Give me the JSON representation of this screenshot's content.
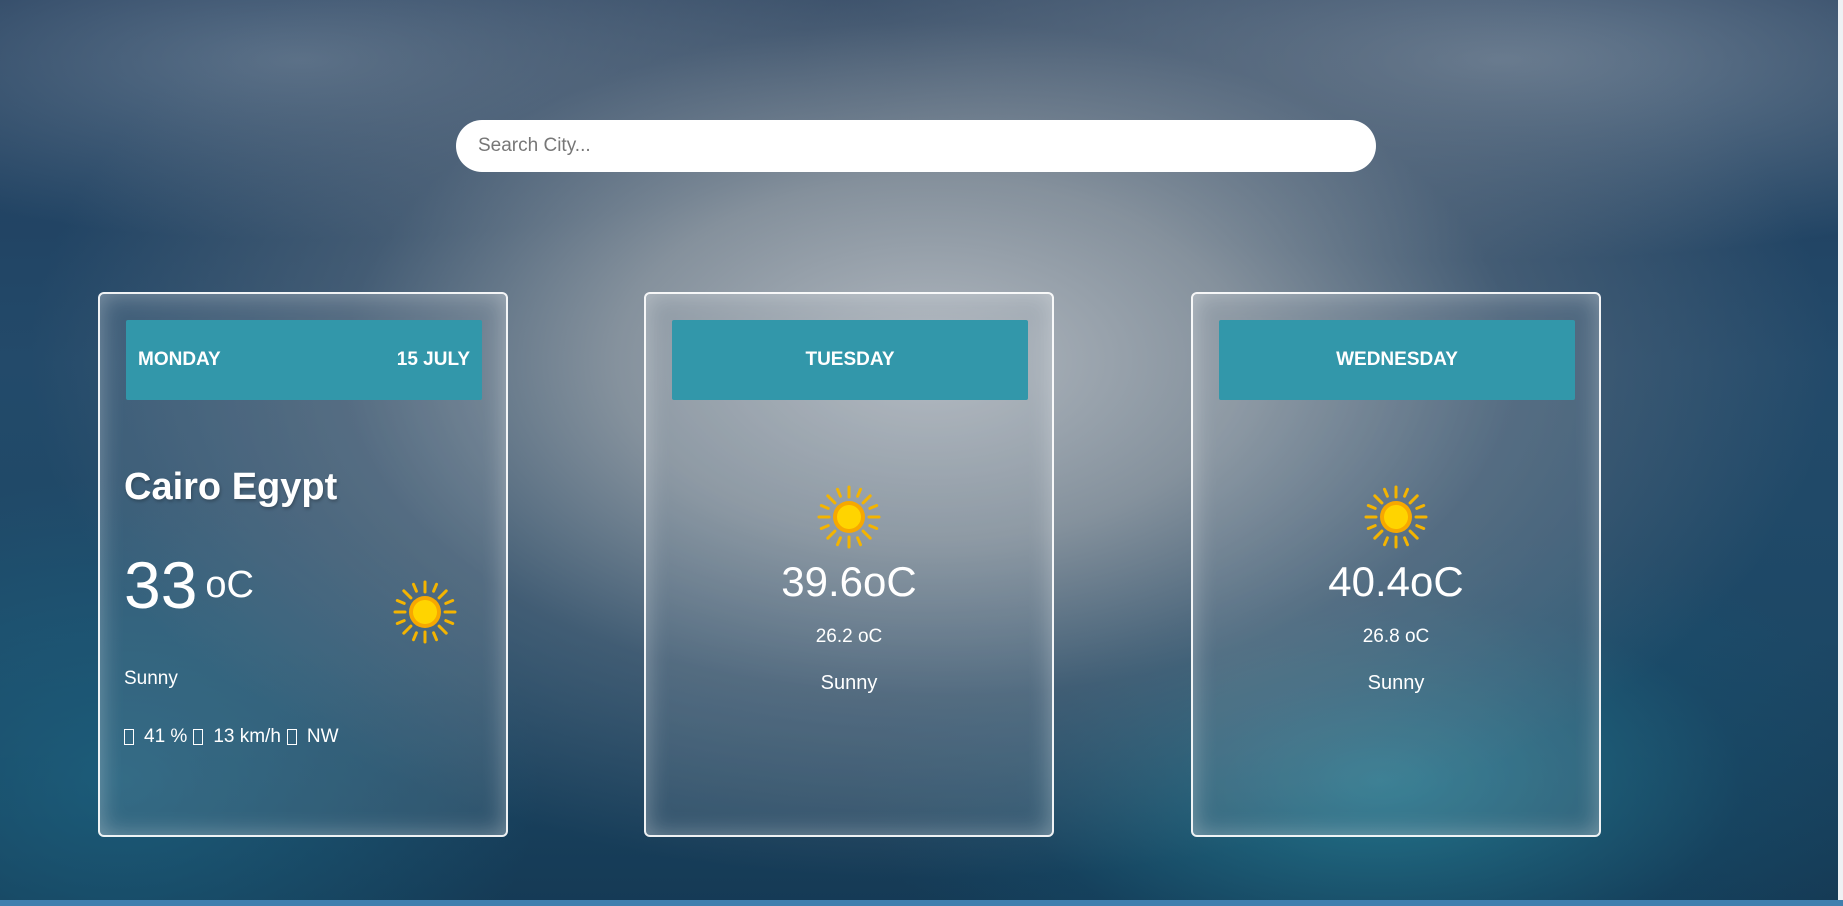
{
  "search": {
    "placeholder": "Search City..."
  },
  "today": {
    "day": "MONDAY",
    "date": "15 JULY",
    "location": "Cairo Egypt",
    "temp": "33",
    "unit": "oC",
    "condition": "Sunny",
    "humidity": "41 %",
    "wind_speed": "13 km/h",
    "wind_dir": "NW",
    "icon": "sun-icon"
  },
  "forecast": [
    {
      "day": "TUESDAY",
      "max": "39.6oC",
      "min": "26.2 oC",
      "condition": "Sunny",
      "icon": "sun-icon"
    },
    {
      "day": "WEDNESDAY",
      "max": "40.4oC",
      "min": "26.8 oC",
      "condition": "Sunny",
      "icon": "sun-icon"
    }
  ],
  "colors": {
    "header_bg": "#3297aa",
    "bottom_bar": "#3f7fae"
  }
}
